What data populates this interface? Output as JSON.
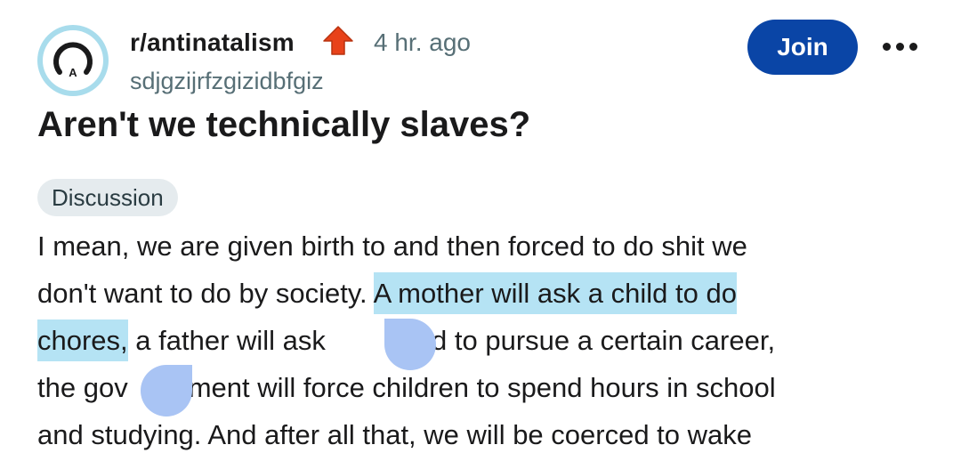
{
  "post": {
    "subreddit": "r/antinatalism",
    "time": "4 hr. ago",
    "username": "sdjgzijrfzgizidbfgiz",
    "join_label": "Join",
    "title": "Aren't we technically slaves?",
    "flair": "Discussion",
    "body_lines": [
      "I mean, we are given birth to and then forced to do shit we",
      "don't want to do by society. ",
      "A mother will ask a child to do",
      "chores,",
      " a father will ask ",
      "child to pursue a certain career,",
      "the gov",
      "ment will force children to spend hours in school",
      "and studying. And after all that, we will be coerced to wake"
    ]
  },
  "icons": {
    "avatar": "antinatalism-logo-icon",
    "upvote": "upvote-arrow-icon",
    "more": "more-options-icon"
  },
  "colors": {
    "join_button": "#0a45a6",
    "highlight": "#b5e3f4",
    "selection_handle": "#a9c4f4",
    "upvote": "#e8421a",
    "avatar_bg": "#a8dcec"
  }
}
